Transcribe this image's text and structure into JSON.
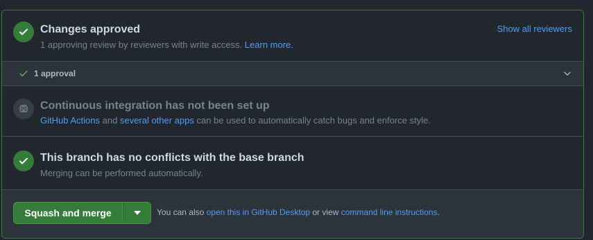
{
  "approved": {
    "title": "Changes approved",
    "subtitle": "1 approving review by reviewers with write access.",
    "learn_more": "Learn more.",
    "show_all_reviewers": "Show all reviewers"
  },
  "approval_summary": {
    "label": "1 approval"
  },
  "ci": {
    "title": "Continuous integration has not been set up",
    "link_actions": "GitHub Actions",
    "text_and": " and ",
    "link_other_apps": "several other apps",
    "text_rest": " can be used to automatically catch bugs and enforce style."
  },
  "conflicts": {
    "title": "This branch has no conflicts with the base branch",
    "subtitle": "Merging can be performed automatically."
  },
  "merge": {
    "button_label": "Squash and merge",
    "note_prefix": "You can also ",
    "link_desktop": "open this in GitHub Desktop",
    "note_middle": " or view ",
    "link_cli": "command line instructions",
    "note_suffix": "."
  },
  "colors": {
    "success": "#347d39",
    "link": "#539bf5",
    "background": "#22272e",
    "panel": "#2d333b"
  },
  "icons": {
    "approved": "check-circle-icon",
    "approval": "check-icon",
    "expand": "chevron-down-icon",
    "ci": "robot-icon",
    "conflicts": "check-circle-icon",
    "dropdown": "triangle-down-icon"
  }
}
